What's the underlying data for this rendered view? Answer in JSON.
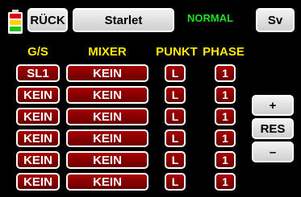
{
  "header": {
    "back_label": "RÜCK",
    "model_name": "Starlet",
    "mode": "NORMAL",
    "save_label": "Sv"
  },
  "battery": {
    "icon": "battery-icon",
    "segments": [
      "#e00000",
      "#ffd400",
      "#1fc21f"
    ]
  },
  "columns": [
    "G/S",
    "MIXER",
    "PUNKT",
    "PHASE"
  ],
  "rows": [
    {
      "gs": "SL1",
      "mixer": "KEIN",
      "punkt": "L",
      "phase": "1"
    },
    {
      "gs": "KEIN",
      "mixer": "KEIN",
      "punkt": "L",
      "phase": "1"
    },
    {
      "gs": "KEIN",
      "mixer": "KEIN",
      "punkt": "L",
      "phase": "1"
    },
    {
      "gs": "KEIN",
      "mixer": "KEIN",
      "punkt": "L",
      "phase": "1"
    },
    {
      "gs": "KEIN",
      "mixer": "KEIN",
      "punkt": "L",
      "phase": "1"
    },
    {
      "gs": "KEIN",
      "mixer": "KEIN",
      "punkt": "L",
      "phase": "1"
    }
  ],
  "side": {
    "plus_label": "+",
    "reset_label": "RES",
    "minus_label": "–"
  }
}
